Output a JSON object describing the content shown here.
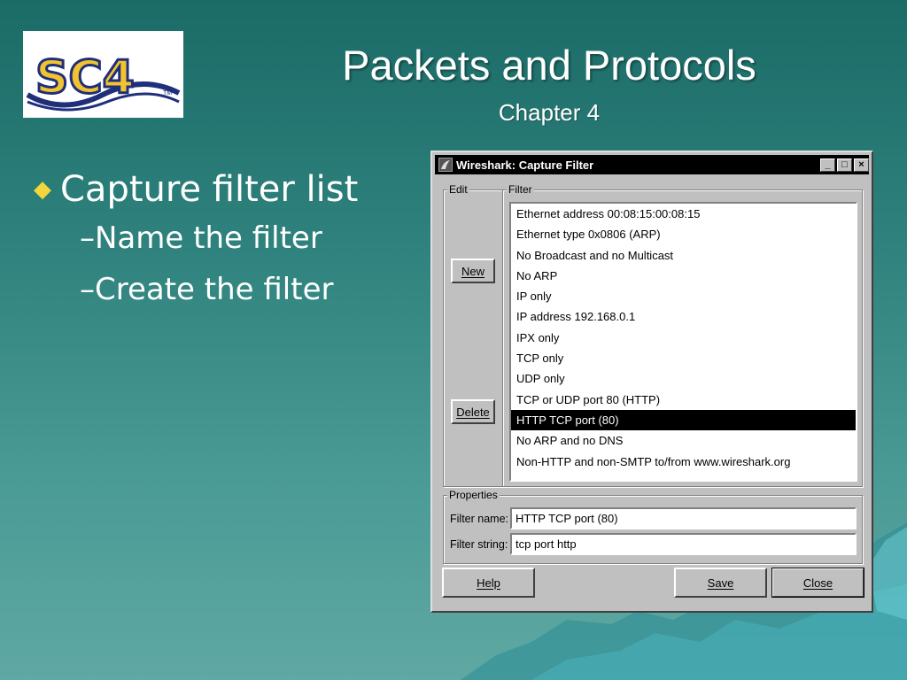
{
  "slide": {
    "title": "Packets and Protocols",
    "subtitle": "Chapter 4",
    "logo_text": "SC4",
    "bullets": {
      "main": "Capture filter list",
      "sub": [
        "Name the filter",
        "Create the filter"
      ],
      "sub_marker": "–",
      "main_marker": "◆"
    }
  },
  "dialog": {
    "title": "Wireshark: Capture Filter",
    "edit_group_label": "Edit",
    "filter_group_label": "Filter",
    "new_button": "New",
    "delete_button": "Delete",
    "filters": [
      "Ethernet address 00:08:15:00:08:15",
      "Ethernet type 0x0806 (ARP)",
      "No Broadcast and no Multicast",
      "No ARP",
      "IP only",
      "IP address 192.168.0.1",
      "IPX only",
      "TCP only",
      "UDP only",
      "TCP or UDP port 80 (HTTP)",
      "HTTP TCP port (80)",
      "No ARP and no DNS",
      "Non-HTTP and non-SMTP to/from www.wireshark.org"
    ],
    "selected_filter": "HTTP TCP port (80)",
    "properties_group_label": "Properties",
    "filter_name_label": "Filter name:",
    "filter_name_value": "HTTP TCP port (80)",
    "filter_string_label": "Filter string:",
    "filter_string_value": "tcp port http",
    "help_button": "Help",
    "save_button": "Save",
    "close_button": "Close",
    "window_controls": {
      "minimize": "_",
      "maximize": "□",
      "close": "×"
    }
  },
  "colors": {
    "background_top": "#1b6b67",
    "background_bottom": "#5fa8a3",
    "bullet_marker": "#f2d63a",
    "dialog_face": "#c0c0c0",
    "selection": "#000000"
  }
}
